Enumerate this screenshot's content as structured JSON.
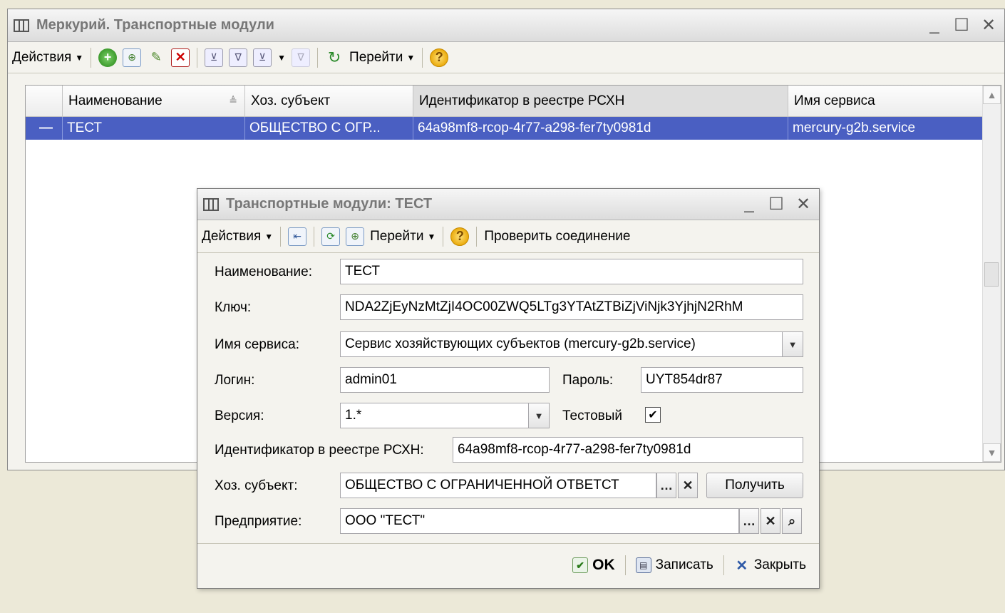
{
  "main": {
    "title": "Меркурий. Транспортные модули",
    "window_buttons": [
      "_",
      "☐",
      "✕"
    ],
    "toolbar": {
      "actions_label": "Действия",
      "goto_label": "Перейти",
      "icons": [
        "add-icon",
        "copy-icon",
        "edit-icon",
        "delete-icon",
        "filter-icon",
        "filter-settings-icon",
        "filter-list-icon",
        "filter-clear-icon",
        "refresh-icon",
        "help-icon"
      ]
    },
    "grid": {
      "columns": [
        "Наименование",
        "Хоз. субъект",
        "Идентификатор в реестре РСХН",
        "Имя сервиса"
      ],
      "rows": [
        {
          "marker": "—",
          "name": "ТЕСТ",
          "subject": "ОБЩЕСТВО С ОГР...",
          "id": "64a98mf8-rcop-4r77-a298-fer7ty0981d",
          "service": "mercury-g2b.service"
        }
      ]
    }
  },
  "dialog": {
    "title": "Транспортные модули: ТЕСТ",
    "window_buttons": [
      "_",
      "☐",
      "✕"
    ],
    "toolbar": {
      "actions_label": "Действия",
      "goto_label": "Перейти",
      "check_label": "Проверить соединение"
    },
    "form": {
      "name_label": "Наименование:",
      "name_value": "ТЕСТ",
      "key_label": "Ключ:",
      "key_value": "NDA2ZjEyNzMtZjI4OC00ZWQ5LTg3YTAtZTBiZjViNjk3YjhjN2RhM",
      "service_label": "Имя сервиса:",
      "service_value": "Сервис хозяйствующих субъектов (mercury-g2b.service)",
      "login_label": "Логин:",
      "login_value": "admin01",
      "password_label": "Пароль:",
      "password_value": "UYT854dr87",
      "version_label": "Версия:",
      "version_value": "1.*",
      "test_label": "Тестовый",
      "test_checked": true,
      "registry_label": "Идентификатор в реестре РСХН:",
      "registry_value": "64a98mf8-rcop-4r77-a298-fer7ty0981d",
      "subject_label": "Хоз. субъект:",
      "subject_value": "ОБЩЕСТВО С ОГРАНИЧЕННОЙ ОТВЕТСТ",
      "get_label": "Получить",
      "enterprise_label": "Предприятие:",
      "enterprise_value": "ООО \"ТЕСТ\""
    },
    "footer": {
      "ok_label": "OK",
      "save_label": "Записать",
      "close_label": "Закрыть"
    }
  }
}
